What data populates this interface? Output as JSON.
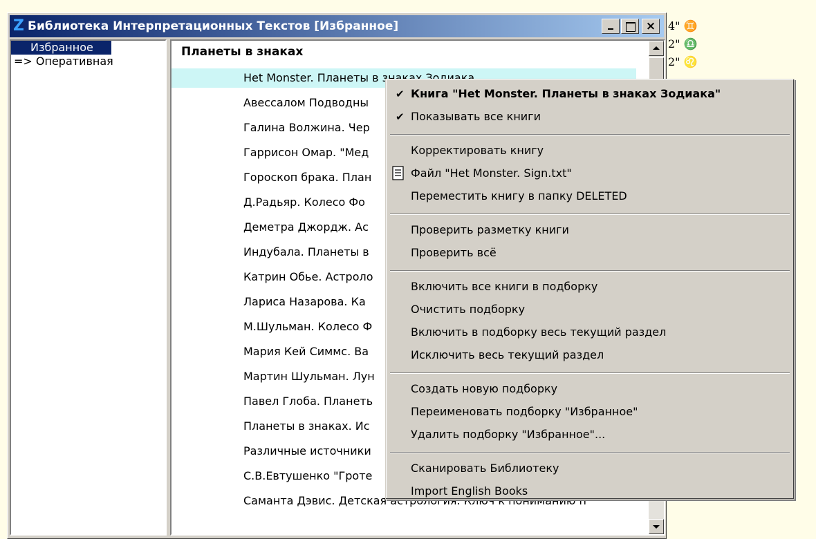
{
  "window": {
    "logo_letter": "Z",
    "title": "Библиотека Интерпретационных Текстов [Избранное]"
  },
  "folders": [
    {
      "label": "Избранное",
      "selected": true
    },
    {
      "label": "=> Оперативная",
      "selected": false
    }
  ],
  "section_header": "Планеты в знаках",
  "books": [
    {
      "label": "Het Monster. Планеты в знаках Зодиака",
      "highlighted": true
    },
    {
      "label": "Авессалом Подводны"
    },
    {
      "label": "Галина Волжина. Чер"
    },
    {
      "label": "Гаррисон Омар. \"Мед"
    },
    {
      "label": "Гороскоп брака. План"
    },
    {
      "label": "Д.Радьяр. Колесо Фо"
    },
    {
      "label": "Деметра Джордж. Ас"
    },
    {
      "label": "Индубала. Планеты в"
    },
    {
      "label": "Катрин Обье. Астроло"
    },
    {
      "label": "Лариса Назарова. Ка"
    },
    {
      "label": "М.Шульман. Колесо Ф"
    },
    {
      "label": "Мария Кей Симмс. Ва"
    },
    {
      "label": "Мартин Шульман. Лун"
    },
    {
      "label": "Павел Глоба. Планеть"
    },
    {
      "label": "Планеты в знаках. Ис"
    },
    {
      "label": "Различные источники"
    },
    {
      "label": "С.В.Евтушенко \"Гроте"
    },
    {
      "label": "Саманта Дэвис. Детская астрология. Ключ к пониманию п"
    }
  ],
  "chart_strip": [
    {
      "text": "4\" ♊"
    },
    {
      "text": "2\" ♎"
    },
    {
      "text": "2\" ♌"
    }
  ],
  "context_menu": {
    "groups": [
      [
        {
          "label": "Книга \"Het Monster. Планеты в знаках Зодиака\"",
          "checked": true,
          "bold": true
        },
        {
          "label": "Показывать все книги",
          "checked": true
        }
      ],
      [
        {
          "label": "Корректировать книгу"
        },
        {
          "label": "Файл \"Het Monster. Sign.txt\"",
          "icon": "text-file-icon"
        },
        {
          "label": "Переместить книгу в папку DELETED"
        }
      ],
      [
        {
          "label": "Проверить разметку книги"
        },
        {
          "label": "Проверить всё"
        }
      ],
      [
        {
          "label": "Включить все книги в подборку"
        },
        {
          "label": "Очистить подборку"
        },
        {
          "label": "Включить в подборку весь текущий раздел"
        },
        {
          "label": "Исключить весь текущий раздел"
        }
      ],
      [
        {
          "label": "Создать новую подборку"
        },
        {
          "label": "Переименовать подборку \"Избранное\""
        },
        {
          "label": "Удалить подборку \"Избранное\"..."
        }
      ],
      [
        {
          "label": "Сканировать Библиотеку"
        },
        {
          "label": "Import English Books"
        }
      ]
    ]
  },
  "colors": {
    "title_bar_start": "#0a246a",
    "title_bar_end": "#a6caf0",
    "selection": "#0a246a",
    "row_highlight": "#cdf6f6",
    "desktop": "#fffde8"
  }
}
